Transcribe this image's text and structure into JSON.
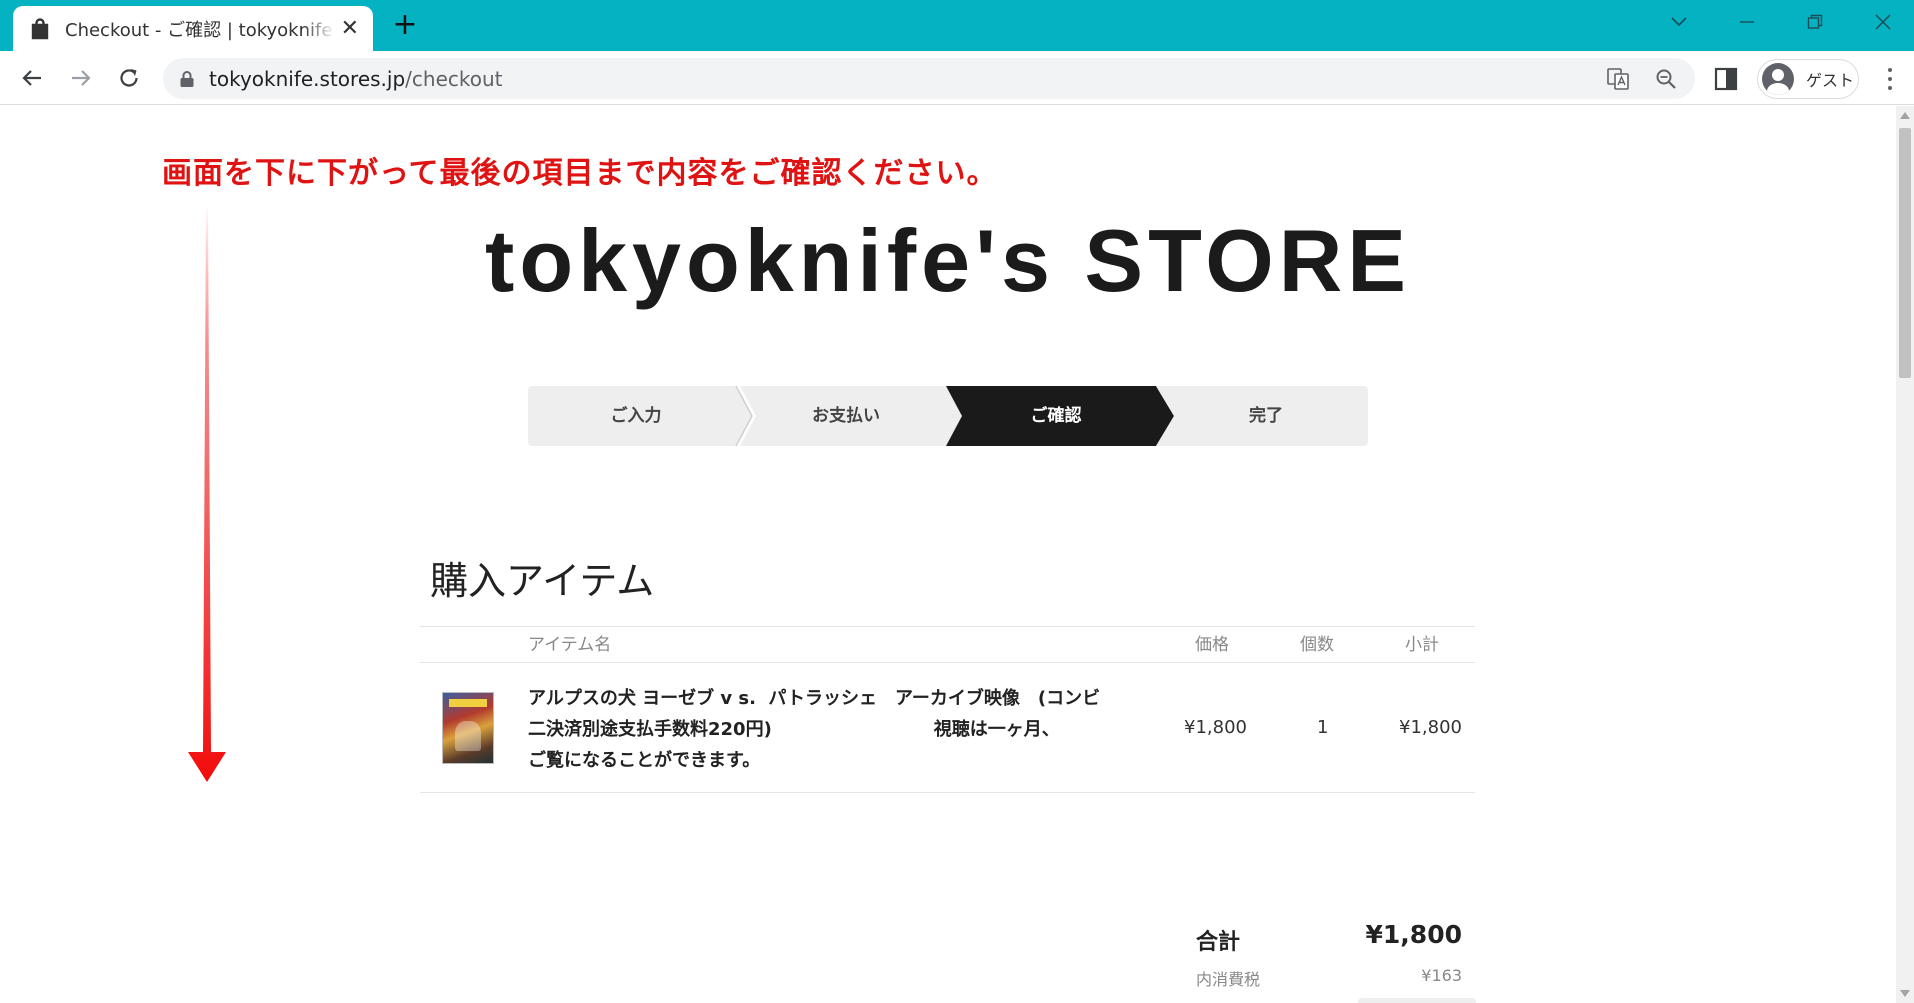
{
  "browser": {
    "tab_title": "Checkout - ご確認 | tokyoknife's STORE",
    "url_host": "tokyoknife.stores.jp",
    "url_path": "/checkout",
    "profile_label": "ゲスト",
    "new_tab_label": "+",
    "tab_close_label": "✕"
  },
  "annotation": {
    "text": "画面を下に下がって最後の項目まで内容をご確認ください。",
    "color": "#e01313"
  },
  "store": {
    "title": "tokyoknife's STORE"
  },
  "steps": [
    {
      "label": "ご入力",
      "active": false
    },
    {
      "label": "お支払い",
      "active": false
    },
    {
      "label": "ご確認",
      "active": true
    },
    {
      "label": "完了",
      "active": false
    }
  ],
  "items_section": {
    "heading": "購入アイテム",
    "columns": {
      "name": "アイテム名",
      "price": "価格",
      "quantity": "個数",
      "subtotal": "小計"
    },
    "rows": [
      {
        "name": "アルプスの犬 ヨーゼブ v s.  パトラッシェ　アーカイブ映像　(コンビ\n二決済別途支払手数料220円)　　　　　　　　　視聴は一ヶ月、\nご覧になることができます。",
        "price": "¥1,800",
        "quantity": "1",
        "subtotal": "¥1,800"
      }
    ],
    "total_label": "合計",
    "total_value": "¥1,800",
    "tax_label": "内消費税",
    "tax_value": "¥163"
  },
  "colors": {
    "titlebar": "#05b2c1",
    "step_active": "#1a1a1a",
    "step_inactive": "#eeeeee"
  },
  "icons": [
    "tab-favicon-icon",
    "close-icon",
    "plus-icon",
    "chevron-down-icon",
    "minimize-icon",
    "restore-icon",
    "back-icon",
    "forward-icon",
    "reload-icon",
    "lock-icon",
    "translate-icon",
    "zoom-icon",
    "side-panel-icon",
    "avatar-icon",
    "more-icon"
  ]
}
